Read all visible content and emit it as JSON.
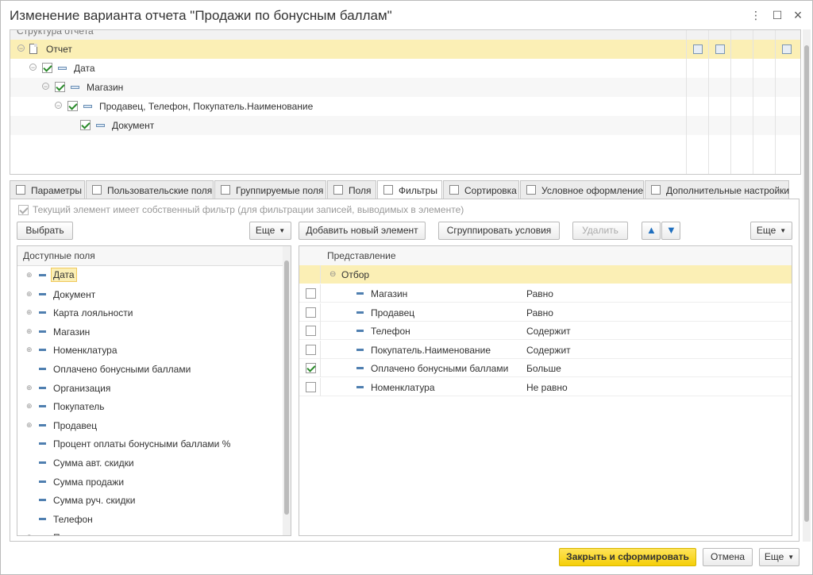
{
  "window": {
    "title": "Изменение варианта отчета \"Продажи по бонусным баллам\"",
    "controls": [
      "⋮",
      "☐",
      "×"
    ]
  },
  "structure": {
    "header": "Структура отчета",
    "rows": [
      {
        "label": "Отчет"
      },
      {
        "label": "Дата"
      },
      {
        "label": "Магазин"
      },
      {
        "label": "Продавец, Телефон, Покупатель.Наименование"
      },
      {
        "label": "Документ"
      }
    ]
  },
  "tabs": [
    {
      "label": "Параметры"
    },
    {
      "label": "Пользовательские поля"
    },
    {
      "label": "Группируемые поля"
    },
    {
      "label": "Поля"
    },
    {
      "label": "Фильтры",
      "active": true
    },
    {
      "label": "Сортировка"
    },
    {
      "label": "Условное оформление"
    },
    {
      "label": "Дополнительные настройки"
    }
  ],
  "filters": {
    "own_filter_label": "Текущий элемент имеет собственный фильтр (для фильтрации записей, выводимых в элементе)",
    "own_filter_checked": true,
    "select_button": "Выбрать",
    "more_button": "Еще",
    "add_button": "Добавить новый элемент",
    "group_button": "Сгруппировать условия",
    "delete_button": "Удалить",
    "more_button_right": "Еще",
    "available_header": "Доступные поля",
    "available_fields": [
      {
        "label": "Дата",
        "expandable": true,
        "highlight": true
      },
      {
        "label": "Документ",
        "expandable": true
      },
      {
        "label": "Карта лояльности",
        "expandable": true
      },
      {
        "label": "Магазин",
        "expandable": true
      },
      {
        "label": "Номенклатура",
        "expandable": true
      },
      {
        "label": "Оплачено бонусными баллами",
        "expandable": false
      },
      {
        "label": "Организация",
        "expandable": true
      },
      {
        "label": "Покупатель",
        "expandable": true
      },
      {
        "label": "Продавец",
        "expandable": true
      },
      {
        "label": "Процент оплаты бонусными баллами %",
        "expandable": false
      },
      {
        "label": "Сумма авт. скидки",
        "expandable": false
      },
      {
        "label": "Сумма продажи",
        "expandable": false
      },
      {
        "label": "Сумма руч. скидки",
        "expandable": false
      },
      {
        "label": "Телефон",
        "expandable": false
      },
      {
        "label": "Параметры",
        "expandable": true
      }
    ],
    "table_header": "Представление",
    "group_label": "Отбор",
    "conditions": [
      {
        "field": "Магазин",
        "comparison": "Равно",
        "checked": false
      },
      {
        "field": "Продавец",
        "comparison": "Равно",
        "checked": false
      },
      {
        "field": "Телефон",
        "comparison": "Содержит",
        "checked": false
      },
      {
        "field": "Покупатель.Наименование",
        "comparison": "Содержит",
        "checked": false
      },
      {
        "field": "Оплачено бонусными баллами",
        "comparison": "Больше",
        "checked": true
      },
      {
        "field": "Номенклатура",
        "comparison": "Не равно",
        "checked": false
      }
    ]
  },
  "footer": {
    "close_build": "Закрыть и сформировать",
    "cancel": "Отмена",
    "more": "Еще"
  },
  "colors": {
    "selected_row": "#fbefb5",
    "primary_button": "#f5cf08",
    "checkmark": "#2a8a2a",
    "arrow": "#1f6fbf"
  }
}
